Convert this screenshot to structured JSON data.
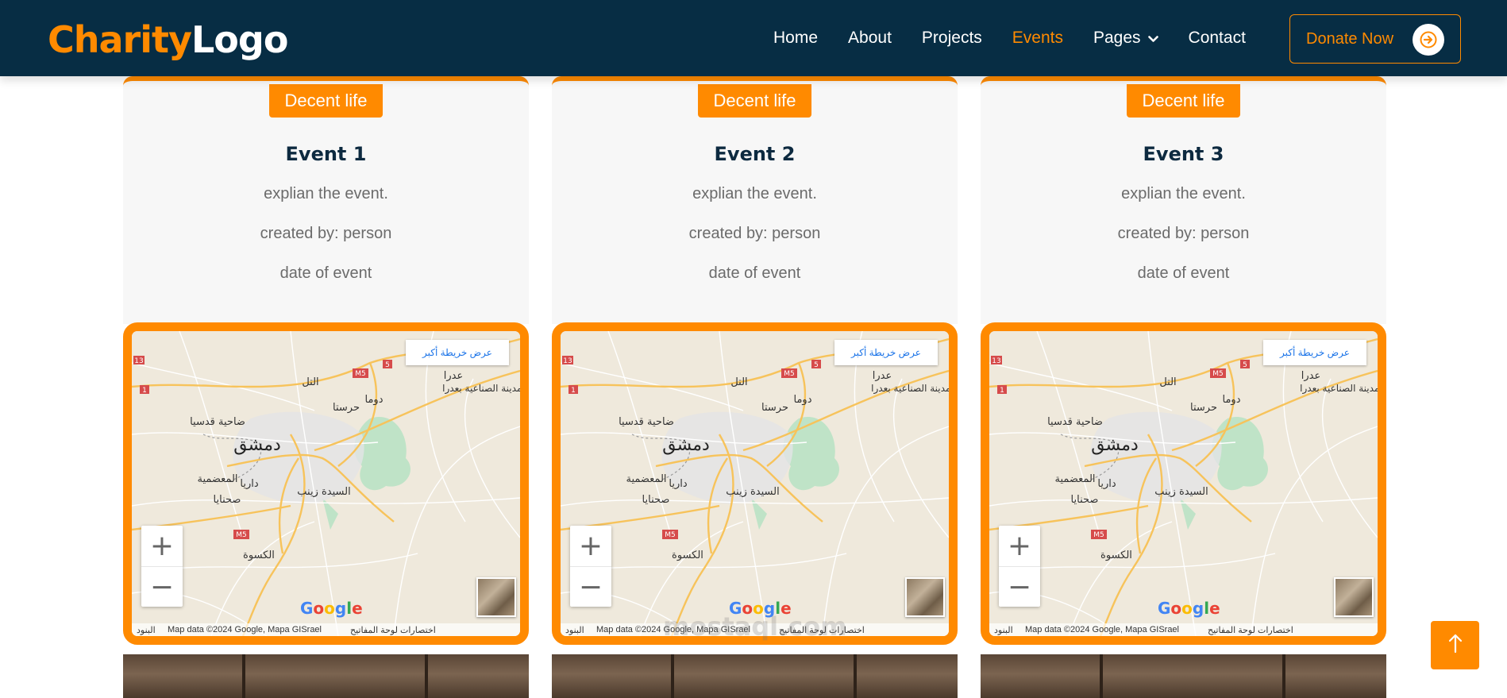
{
  "header": {
    "logo_part1": "Charity",
    "logo_part2": "Logo",
    "nav": {
      "home": "Home",
      "about": "About",
      "projects": "Projects",
      "events": "Events",
      "pages": "Pages",
      "contact": "Contact"
    },
    "donate_label": "Donate Now"
  },
  "events": [
    {
      "badge": "Decent life",
      "title": "Event 1",
      "desc": "explian the event.",
      "created_by": "created by: person",
      "date": "date of event"
    },
    {
      "badge": "Decent life",
      "title": "Event 2",
      "desc": "explian the event.",
      "created_by": "created by: person",
      "date": "date of event"
    },
    {
      "badge": "Decent life",
      "title": "Event 3",
      "desc": "explian the event.",
      "created_by": "created by: person",
      "date": "date of event"
    }
  ],
  "map": {
    "larger_map": "عرض خريطة أكبر",
    "zoom_in": "+",
    "zoom_out": "−",
    "attribution": "Map data ©2024 Google, Mapa GISrael",
    "terms": "البنود",
    "shortcuts": "اختصارات لوحة المفاتيح",
    "google": "Google",
    "labels": {
      "damascus": "دمشق",
      "tal": "التل",
      "harasta": "حرستا",
      "douma": "دوما",
      "adra": "عدرا",
      "industrial": "المدينة الصناعية بعدرا",
      "qudsaya": "ضاحية قدسيا",
      "muadamiya": "المعضمية",
      "daraya": "داريا",
      "sayyida": "السيدة زينب",
      "sahnaya": "صحنايا",
      "kiswah": "الكسوة"
    },
    "road_labels": [
      "13",
      "1",
      "M5",
      "5",
      "M5"
    ]
  },
  "watermark": "mostaql.com",
  "colors": {
    "header_bg": "#072d44",
    "accent": "#ff8a00",
    "card_bg": "#f7f7f7",
    "title": "#0d2a40"
  }
}
